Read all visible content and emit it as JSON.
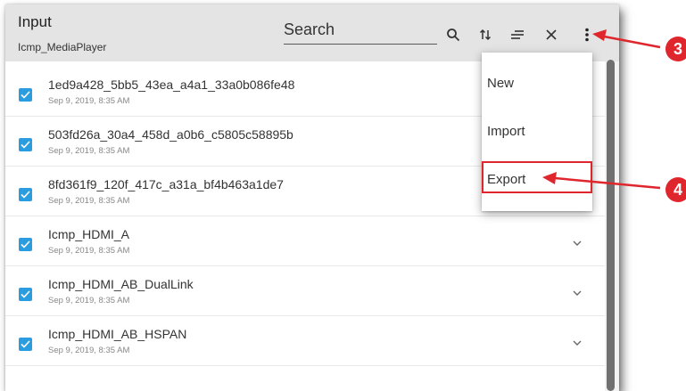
{
  "header": {
    "title": "Input",
    "subtitle": "Icmp_MediaPlayer",
    "search_placeholder": "Search"
  },
  "toolbar_icons": [
    "search-icon",
    "sort-icon",
    "filter-icon",
    "close-icon",
    "more-vertical-icon"
  ],
  "items": [
    {
      "name": "1ed9a428_5bb5_43ea_a4a1_33a0b086fe48",
      "date": "Sep 9, 2019, 8:35 AM",
      "checked": true
    },
    {
      "name": "503fd26a_30a4_458d_a0b6_c5805c58895b",
      "date": "Sep 9, 2019, 8:35 AM",
      "checked": true
    },
    {
      "name": "8fd361f9_120f_417c_a31a_bf4b463a1de7",
      "date": "Sep 9, 2019, 8:35 AM",
      "checked": true
    },
    {
      "name": "Icmp_HDMI_A",
      "date": "Sep 9, 2019, 8:35 AM",
      "checked": true
    },
    {
      "name": "Icmp_HDMI_AB_DualLink",
      "date": "Sep 9, 2019, 8:35 AM",
      "checked": true
    },
    {
      "name": "Icmp_HDMI_AB_HSPAN",
      "date": "Sep 9, 2019, 8:35 AM",
      "checked": true
    }
  ],
  "menu": {
    "new_label": "New",
    "import_label": "Import",
    "export_label": "Export"
  },
  "callouts": {
    "three": "3",
    "four": "4"
  },
  "colors": {
    "accent_checkbox": "#2a9de0",
    "callout_red": "#e0262d",
    "header_bg": "#e4e4e4"
  }
}
